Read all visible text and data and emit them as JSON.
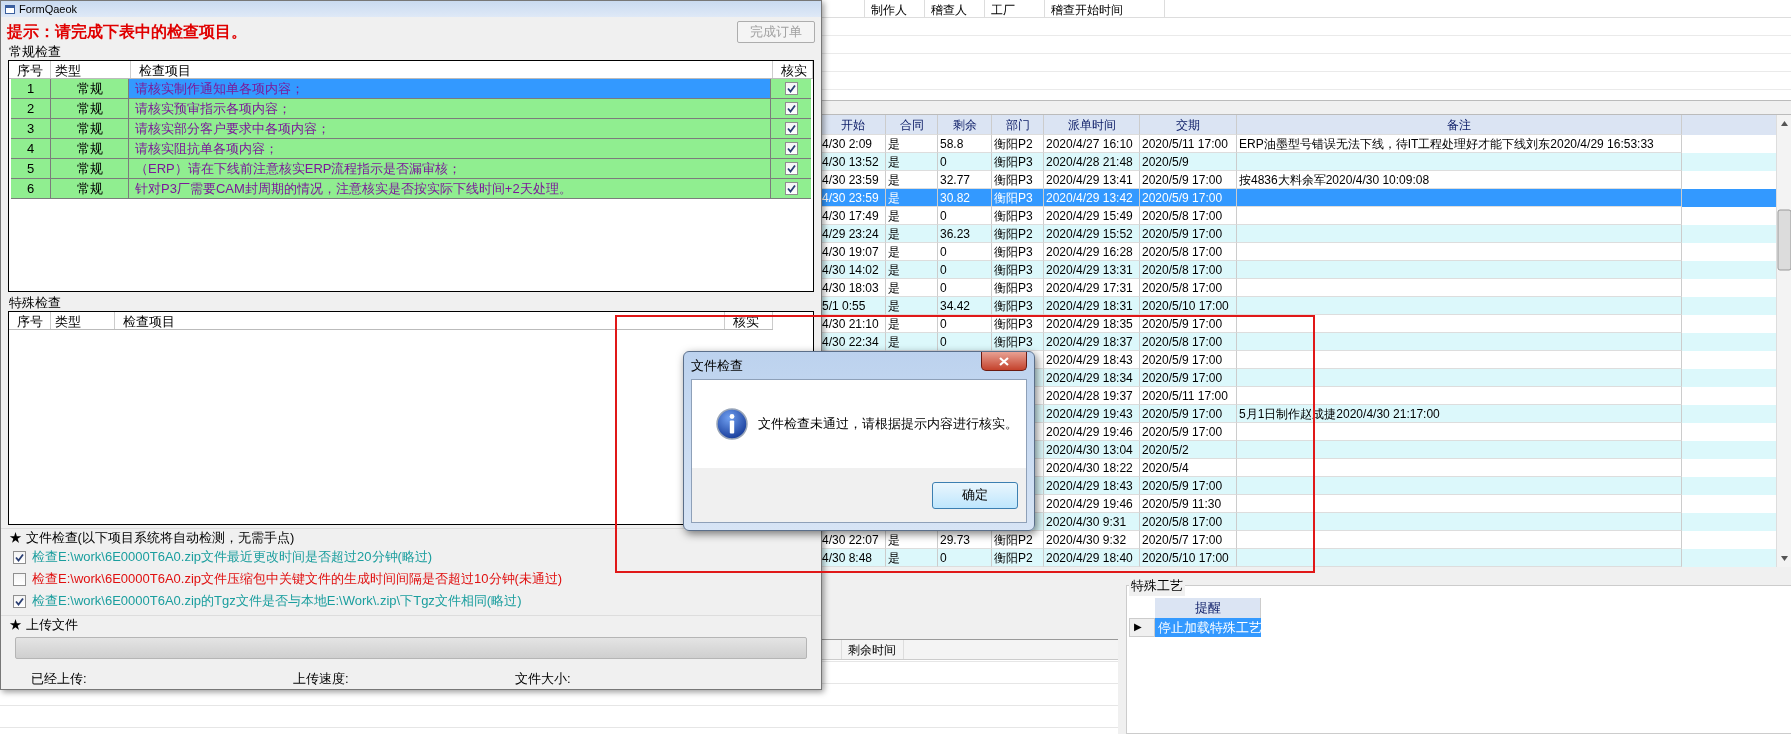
{
  "top_grid": {
    "columns": [
      "制作人",
      "稽查人",
      "工厂",
      "稽查开始时间"
    ]
  },
  "main_grid": {
    "columns": [
      "开始",
      "合同",
      "剩余",
      "部门",
      "派单时间",
      "交期",
      "备注"
    ],
    "rows": [
      {
        "start": "4/30 2:09",
        "contract": "是",
        "remaining": "58.8",
        "dept": "衡阳P2",
        "dispatch": "2020/4/27 16:10",
        "due": "2020/5/11 17:00",
        "note": "ERP油墨型号错误无法下线，待IT工程处理好才能下线刘东2020/4/29 16:53:33",
        "selected": false
      },
      {
        "start": "4/30 13:52",
        "contract": "是",
        "remaining": "0",
        "dept": "衡阳P3",
        "dispatch": "2020/4/28 21:48",
        "due": "2020/5/9",
        "selected": false
      },
      {
        "start": "4/30 23:59",
        "contract": "是",
        "remaining": "32.77",
        "dept": "衡阳P3",
        "dispatch": "2020/4/29 13:41",
        "due": "2020/5/9 17:00",
        "note": "按4836大料余军2020/4/30 10:09:08",
        "selected": false
      },
      {
        "start": "4/30 23:59",
        "contract": "是",
        "remaining": "30.82",
        "dept": "衡阳P3",
        "dispatch": "2020/4/29 13:42",
        "due": "2020/5/9 17:00",
        "selected": true
      },
      {
        "start": "4/30 17:49",
        "contract": "是",
        "remaining": "0",
        "dept": "衡阳P3",
        "dispatch": "2020/4/29 15:49",
        "due": "2020/5/8 17:00",
        "selected": false
      },
      {
        "start": "4/29 23:24",
        "contract": "是",
        "remaining": "36.23",
        "dept": "衡阳P2",
        "dispatch": "2020/4/29 15:52",
        "due": "2020/5/9 17:00",
        "selected": false
      },
      {
        "start": "4/30 19:07",
        "contract": "是",
        "remaining": "0",
        "dept": "衡阳P3",
        "dispatch": "2020/4/29 16:28",
        "due": "2020/5/8 17:00",
        "selected": false
      },
      {
        "start": "4/30 14:02",
        "contract": "是",
        "remaining": "0",
        "dept": "衡阳P3",
        "dispatch": "2020/4/29 13:31",
        "due": "2020/5/8 17:00",
        "selected": false
      },
      {
        "start": "4/30 18:03",
        "contract": "是",
        "remaining": "0",
        "dept": "衡阳P3",
        "dispatch": "2020/4/29 17:31",
        "due": "2020/5/8 17:00",
        "selected": false
      },
      {
        "start": "5/1 0:55",
        "contract": "是",
        "remaining": "34.42",
        "dept": "衡阳P3",
        "dispatch": "2020/4/29 18:31",
        "due": "2020/5/10 17:00",
        "selected": false
      },
      {
        "start": "4/30 21:10",
        "contract": "是",
        "remaining": "0",
        "dept": "衡阳P3",
        "dispatch": "2020/4/29 18:35",
        "due": "2020/5/9 17:00",
        "selected": false
      },
      {
        "start": "4/30 22:34",
        "contract": "是",
        "remaining": "0",
        "dept": "衡阳P3",
        "dispatch": "2020/4/29 18:37",
        "due": "2020/5/8 17:00",
        "selected": false
      },
      {
        "dispatch": "2020/4/29 18:43",
        "due": "2020/5/9 17:00",
        "selected": false
      },
      {
        "dispatch": "2020/4/29 18:34",
        "due": "2020/5/9 17:00",
        "selected": false
      },
      {
        "dispatch": "2020/4/28 19:37",
        "due": "2020/5/11 17:00",
        "selected": false
      },
      {
        "dispatch": "2020/4/29 19:43",
        "due": "2020/5/9 17:00",
        "note": "5月1日制作赵成捷2020/4/30 21:17:00",
        "selected": false
      },
      {
        "dispatch": "2020/4/29 19:46",
        "due": "2020/5/9 17:00",
        "selected": false
      },
      {
        "dispatch": "2020/4/30 13:04",
        "due": "2020/5/2",
        "selected": false
      },
      {
        "dispatch": "2020/4/30 18:22",
        "due": "2020/5/4",
        "selected": false
      },
      {
        "dispatch": "2020/4/29 18:43",
        "due": "2020/5/9 17:00",
        "selected": false
      },
      {
        "dispatch": "2020/4/29 19:46",
        "due": "2020/5/9 11:30",
        "selected": false
      },
      {
        "dispatch": "2020/4/30 9:31",
        "due": "2020/5/8 17:00",
        "selected": false
      },
      {
        "start": "4/30 22:07",
        "contract": "是",
        "remaining": "29.73",
        "dept": "衡阳P2",
        "dispatch": "2020/4/30 9:32",
        "due": "2020/5/7 17:00",
        "selected": false
      },
      {
        "start": "4/30 8:48",
        "contract": "是",
        "remaining": "0",
        "dept": "衡阳P2",
        "dispatch": "2020/4/29 18:40",
        "due": "2020/5/10 17:00",
        "selected": false
      }
    ]
  },
  "bottom_grid": {
    "columns": [
      "剩余时间"
    ]
  },
  "special_process": {
    "label": "特殊工艺",
    "columns": [
      "提醒"
    ],
    "rows": [
      {
        "marker": "▶",
        "text": "停止加载特殊工艺",
        "selected": true
      }
    ]
  },
  "form": {
    "title": "FormQaeok",
    "hint": "提示：请完成下表中的检查项目。",
    "finish_button": {
      "label": "完成订单",
      "disabled": true
    },
    "routine": {
      "label": "常规检查",
      "columns": [
        "序号",
        "类型",
        "检查项目",
        "核实"
      ],
      "rows": [
        {
          "no": "1",
          "type": "常规",
          "item": "请核实制作通知单各项内容；",
          "checked": true,
          "selected": true
        },
        {
          "no": "2",
          "type": "常规",
          "item": "请核实预审指示各项内容；",
          "checked": true,
          "selected": false
        },
        {
          "no": "3",
          "type": "常规",
          "item": "请核实部分客户要求中各项内容；",
          "checked": true,
          "selected": false
        },
        {
          "no": "4",
          "type": "常规",
          "item": "请核实阻抗单各项内容；",
          "checked": true,
          "selected": false
        },
        {
          "no": "5",
          "type": "常规",
          "item": "（ERP）请在下线前注意核实ERP流程指示是否漏审核；",
          "checked": true,
          "selected": false
        },
        {
          "no": "6",
          "type": "常规",
          "item": "针对P3厂需要CAM封周期的情况，注意核实是否按实际下线时间+2天处理。",
          "checked": true,
          "selected": false
        }
      ]
    },
    "special": {
      "label": "特殊检查",
      "columns": [
        "序号",
        "类型",
        "检查项目",
        "核实"
      ]
    },
    "file_check": {
      "title": "★ 文件检查(以下项目系统将自动检测，无需手点)",
      "items": [
        {
          "text": "检查E:\\work\\6E0000T6A0.zip文件最近更改时间是否超过20分钟(略过)",
          "checked": true,
          "color": "#1a9e9e"
        },
        {
          "text": "检查E:\\work\\6E0000T6A0.zip文件压缩包中关键文件的生成时间间隔是否超过10分钟(未通过)",
          "checked": false,
          "color": "#e01010"
        },
        {
          "text": "检查E:\\work\\6E0000T6A0.zip的Tgz文件是否与本地E:\\Work\\.zip\\下Tgz文件相同(略过)",
          "checked": true,
          "color": "#1a9e9e"
        }
      ]
    },
    "upload": {
      "title": "★ 上传文件",
      "level": 0,
      "labels": [
        "已经上传:",
        "上传速度:",
        "文件大小:"
      ]
    }
  },
  "dialog": {
    "title": "文件检查",
    "message": "文件检查未通过，请根据提示内容进行核实。",
    "button": "确定"
  },
  "highlight_box": {
    "shown": true
  }
}
